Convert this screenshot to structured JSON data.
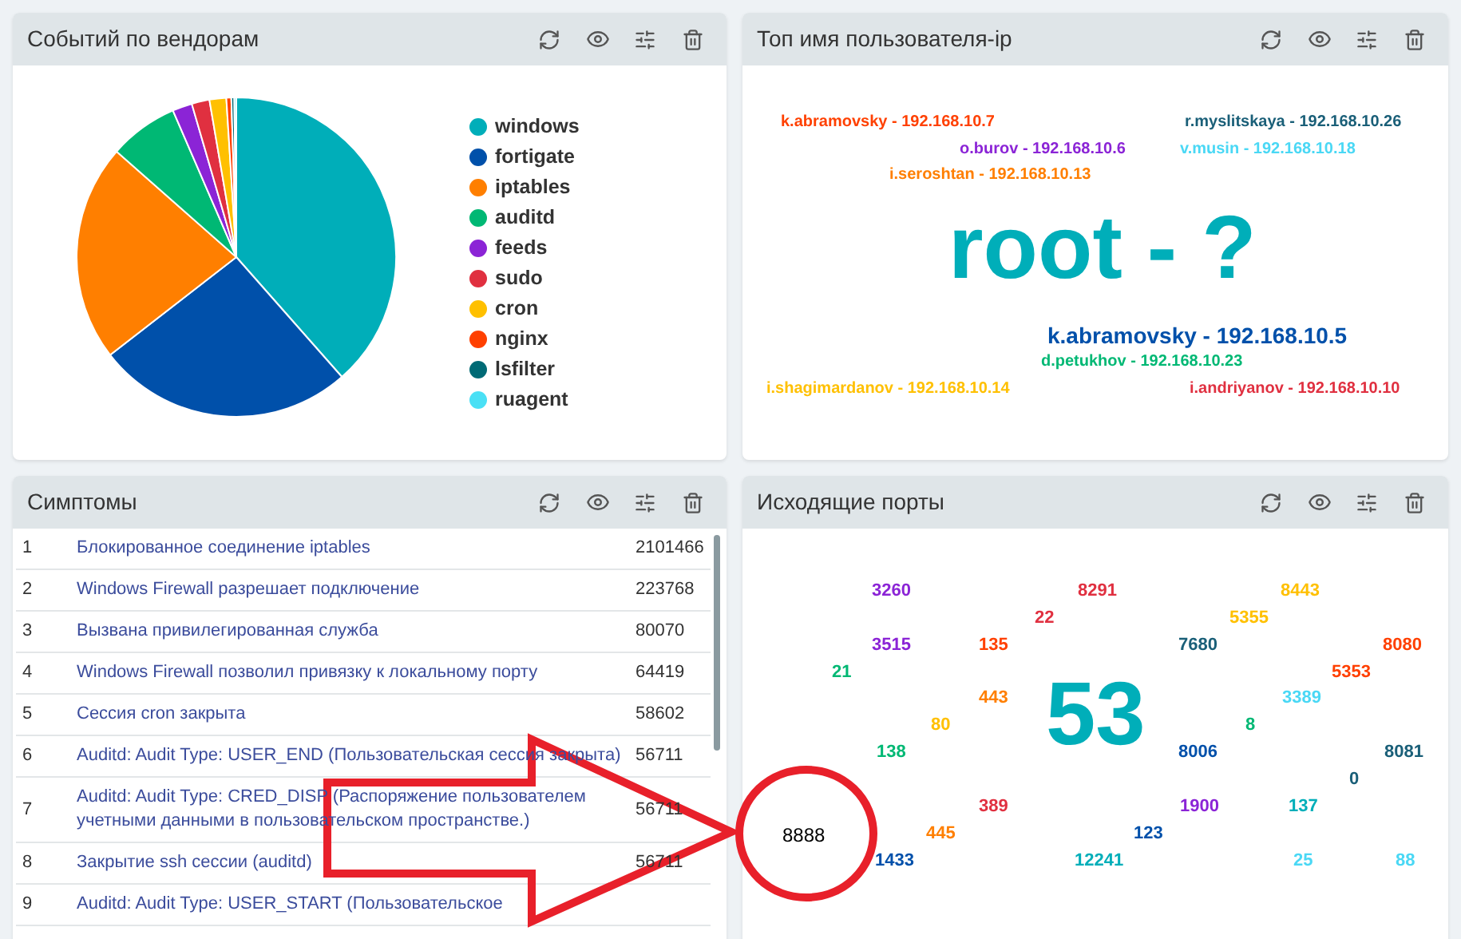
{
  "panels": [
    {
      "title": "Событий по вендорам",
      "kind": "pie",
      "legend": [
        {
          "label": "windows",
          "color": "#00aeb9"
        },
        {
          "label": "fortigate",
          "color": "#0050aa"
        },
        {
          "label": "iptables",
          "color": "#ff7f00"
        },
        {
          "label": "auditd",
          "color": "#00b874"
        },
        {
          "label": "feeds",
          "color": "#8b24d6"
        },
        {
          "label": "sudo",
          "color": "#e03040"
        },
        {
          "label": "cron",
          "color": "#ffc000"
        },
        {
          "label": "nginx",
          "color": "#ff4000"
        },
        {
          "label": "lsfilter",
          "color": "#006a75"
        },
        {
          "label": "ruagent",
          "color": "#4ae0f5"
        }
      ]
    },
    {
      "title": "Топ имя пользователя-ip",
      "kind": "cloud",
      "words": [
        {
          "text": "k.abramovsky - 192.168.10.7",
          "color": "#ff4000",
          "kind": "small"
        },
        {
          "text": "r.myslitskaya - 192.168.10.26",
          "color": "#1a5f78",
          "kind": "small"
        },
        {
          "text": "o.burov - 192.168.10.6",
          "color": "#8b24d6",
          "kind": "small"
        },
        {
          "text": "v.musin - 192.168.10.18",
          "color": "#4ad8f5",
          "kind": "small"
        },
        {
          "text": "i.seroshtan - 192.168.10.13",
          "color": "#ff7f00",
          "kind": "small"
        },
        {
          "text": "root - ?",
          "color": "#00aeb9",
          "kind": "large"
        },
        {
          "text": "k.abramovsky - 192.168.10.5",
          "color": "#0050aa",
          "kind": "medium"
        },
        {
          "text": "d.petukhov - 192.168.10.23",
          "color": "#00b874",
          "kind": "small"
        },
        {
          "text": "i.shagimardanov - 192.168.10.14",
          "color": "#ffc000",
          "kind": "small"
        },
        {
          "text": "i.andriyanov - 192.168.10.10",
          "color": "#e03040",
          "kind": "small"
        }
      ]
    },
    {
      "title": "Симптомы",
      "kind": "table",
      "rows": [
        {
          "index": "1",
          "text": "Блокированное соединение iptables",
          "count": "2101466"
        },
        {
          "index": "2",
          "text": "Windows Firewall разрешает подключение",
          "count": "223768"
        },
        {
          "index": "3",
          "text": "Вызвана привилегированная служба",
          "count": "80070"
        },
        {
          "index": "4",
          "text": "Windows Firewall позволил привязку к локальному порту",
          "count": "64419"
        },
        {
          "index": "5",
          "text": "Сессия cron закрыта",
          "count": "58602"
        },
        {
          "index": "6",
          "text": "Auditd: Audit Type: USER_END (Пользовательская сессия закрыта)",
          "count": "56711"
        },
        {
          "index": "7",
          "text": "Auditd: Audit Type: CRED_DISP (Распоряжение пользователем учетными данными в пользовательском пространстве.)",
          "count": "56711"
        },
        {
          "index": "8",
          "text": "Закрытие ssh сессии (auditd)",
          "count": "56711"
        },
        {
          "index": "9",
          "text": "Auditd: Audit Type: USER_START (Пользовательское",
          "count": ""
        }
      ]
    },
    {
      "title": "Исходящие порты",
      "kind": "cloud2",
      "words": [
        {
          "text": "3260",
          "color": "#8b24d6",
          "kind": "small"
        },
        {
          "text": "8291",
          "color": "#e03040",
          "kind": "small"
        },
        {
          "text": "8443",
          "color": "#ffc000",
          "kind": "small"
        },
        {
          "text": "22",
          "color": "#e03040",
          "kind": "small"
        },
        {
          "text": "5355",
          "color": "#ffc000",
          "kind": "small"
        },
        {
          "text": "3515",
          "color": "#8b24d6",
          "kind": "small"
        },
        {
          "text": "135",
          "color": "#ff4000",
          "kind": "small"
        },
        {
          "text": "7680",
          "color": "#1a5f78",
          "kind": "small"
        },
        {
          "text": "8080",
          "color": "#ff4000",
          "kind": "small"
        },
        {
          "text": "21",
          "color": "#00b874",
          "kind": "small"
        },
        {
          "text": "5353",
          "color": "#ff4000",
          "kind": "small"
        },
        {
          "text": "443",
          "color": "#ff7f00",
          "kind": "small"
        },
        {
          "text": "53",
          "color": "#00aeb9",
          "kind": "large"
        },
        {
          "text": "3389",
          "color": "#4ad8f5",
          "kind": "small"
        },
        {
          "text": "80",
          "color": "#ffc000",
          "kind": "small"
        },
        {
          "text": "8",
          "color": "#00b874",
          "kind": "small"
        },
        {
          "text": "138",
          "color": "#00b874",
          "kind": "small"
        },
        {
          "text": "8006",
          "color": "#0050aa",
          "kind": "small"
        },
        {
          "text": "8081",
          "color": "#1a5f78",
          "kind": "small"
        },
        {
          "text": "0",
          "color": "#1a5f78",
          "kind": "small"
        },
        {
          "text": "389",
          "color": "#e03040",
          "kind": "small"
        },
        {
          "text": "1900",
          "color": "#8b24d6",
          "kind": "small"
        },
        {
          "text": "137",
          "color": "#00aeb9",
          "kind": "small"
        },
        {
          "text": "445",
          "color": "#ff7f00",
          "kind": "small"
        },
        {
          "text": "123",
          "color": "#0050aa",
          "kind": "small"
        },
        {
          "text": "1433",
          "color": "#0050aa",
          "kind": "small"
        },
        {
          "text": "12241",
          "color": "#00aeb9",
          "kind": "small"
        },
        {
          "text": "25",
          "color": "#4ad8f5",
          "kind": "small"
        },
        {
          "text": "88",
          "color": "#4ad8f5",
          "kind": "small"
        }
      ]
    }
  ],
  "annotation": {
    "label": "8888"
  }
}
